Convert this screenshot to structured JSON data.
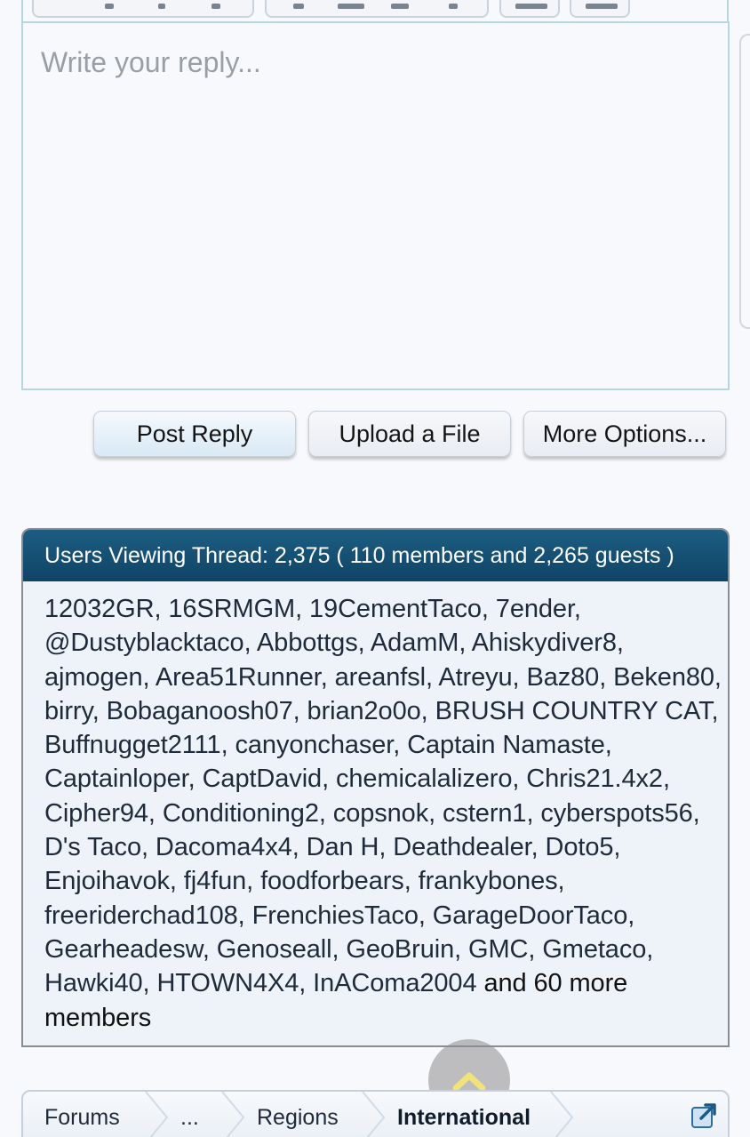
{
  "editor": {
    "placeholder": "Write your reply..."
  },
  "buttons": {
    "post_reply": "Post Reply",
    "upload_file": "Upload a File",
    "more_options": "More Options..."
  },
  "viewers": {
    "header": "Users Viewing Thread: 2,375 ( 110 members and 2,265 guests )",
    "members": [
      "12032GR",
      "16SRMGM",
      "19CementTaco",
      "7ender",
      "@Dustyblacktaco",
      "Abbottgs",
      "AdamM",
      "Ahiskydiver8",
      "ajmogen",
      "Area51Runner",
      "areanfsl",
      "Atreyu",
      "Baz80",
      "Beken80",
      "birry",
      "Bobaganoosh07",
      "brian2o0o",
      "BRUSH COUNTRY CAT",
      "Buffnugget2111",
      "canyonchaser",
      "Captain Namaste",
      "Captainloper",
      "CaptDavid",
      "chemicalalizero",
      "Chris21.4x2",
      "Cipher94",
      "Conditioning2",
      "copsnok",
      "cstern1",
      "cyberspots56",
      "D's Taco",
      "Dacoma4x4",
      "Dan H",
      "Deathdealer",
      "Doto5",
      "Enjoihavok",
      "fj4fun",
      "foodforbears",
      "frankybones",
      "freeriderchad108",
      "FrenchiesTaco",
      "GarageDoorTaco",
      "Gearheadesw",
      "Genoseall",
      "GeoBruin",
      "GMC",
      "Gmetaco",
      "Hawki40",
      "HTOWN4X4",
      "InAComa2004"
    ],
    "more_text": " and 60 more members"
  },
  "breadcrumb": {
    "items": [
      "Forums",
      "...",
      "Regions"
    ],
    "current": "International"
  },
  "icons": {
    "scroll_top": "chevron-up-icon",
    "jump": "external-link-icon"
  },
  "colors": {
    "header_bg": "#0f4466",
    "accent": "#b8d6e2",
    "scroll_chevron": "#f2e27a"
  }
}
